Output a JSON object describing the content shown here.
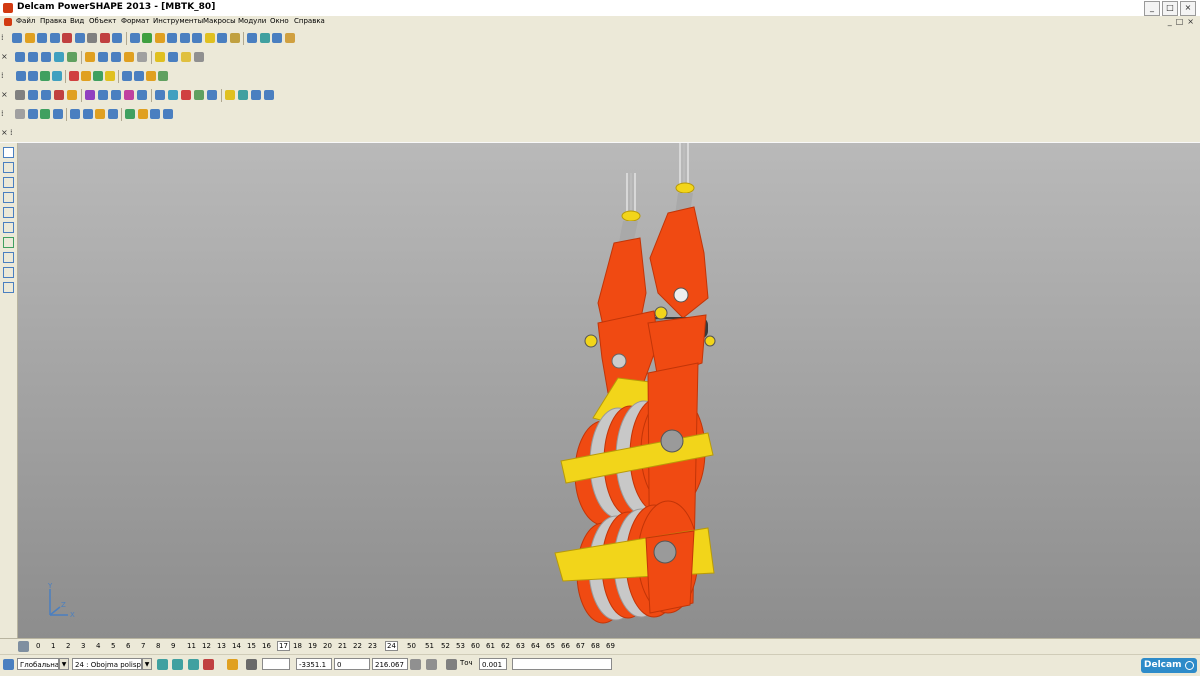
{
  "window": {
    "title": "Delcam PowerSHAPE 2013 - [MBTK_80]",
    "buttons": [
      "_",
      "□",
      "×"
    ],
    "mdi_buttons": [
      "_",
      "□",
      "×"
    ]
  },
  "menu": {
    "items": [
      "Файл",
      "Правка",
      "Вид",
      "Объект",
      "Формат",
      "Инструменты",
      "Макросы",
      "Модули",
      "Окно",
      "Справка"
    ]
  },
  "toolbars": {
    "row1_colors": [
      "#4a7fc0",
      "#e0a020",
      "#4a7fc0",
      "#4a7fc0",
      "#c04040",
      "#4a7fc0",
      "#808080",
      "#c04040",
      "#4a7fc0",
      "#4a7fc0",
      "#40a040",
      "#e0a020",
      "#4a7fc0",
      "#4a7fc0",
      "#4a7fc0",
      "#e0c020",
      "#4a7fc0",
      "#c0a040",
      "#4a7fc0",
      "#40a0a0",
      "#4a7fc0",
      "#d0a040"
    ],
    "row2_colors": [
      "#4a7fc0",
      "#4a7fc0",
      "#4a7fc0",
      "#40a0c0",
      "#60a060",
      "#e0a020",
      "#4a7fc0",
      "#4a7fc0",
      "#e0a020",
      "#a0a0a0",
      "#e0c020",
      "#4a7fc0",
      "#e0c040",
      "#909090"
    ],
    "row3_colors": [
      "#4a7fc0",
      "#4a7fc0",
      "#40a060",
      "#40a0c0",
      "#d04040",
      "#e0a020",
      "#40a060",
      "#e0c020",
      "#4a7fc0",
      "#4a7fc0",
      "#e0a020",
      "#60a060"
    ],
    "row4_colors": [
      "#808080",
      "#4a7fc0",
      "#4a7fc0",
      "#c04040",
      "#e0a020",
      "#9040c0",
      "#4a7fc0",
      "#4a7fc0",
      "#c040a0",
      "#4a7fc0",
      "#4a7fc0",
      "#40a0c0",
      "#d04040",
      "#60a060",
      "#4a7fc0",
      "#e0c020",
      "#40a0a0",
      "#4a7fc0",
      "#4a7fc0"
    ],
    "row5_colors": [
      "#a0a0a0",
      "#4a7fc0",
      "#40a060",
      "#4a7fc0",
      "#4a7fc0",
      "#4a7fc0",
      "#e0a020",
      "#4a7fc0",
      "#40a060",
      "#e0a020",
      "#4a7fc0",
      "#4a7fc0"
    ]
  },
  "left_tools": [
    "select-icon",
    "quick-select-icon",
    "line-icon",
    "curve-icon",
    "rectangle-icon",
    "circle-icon",
    "solid-icon",
    "dimension-icon",
    "arc-icon",
    "axes-icon"
  ],
  "model": {
    "name": "MBTK_80",
    "colors": {
      "body": "#f04a12",
      "body_dark": "#c23508",
      "brackets": "#f2d51a",
      "brackets_dark": "#b89a08",
      "sheave": "#c8c8c8",
      "rope": "#d8d8d8",
      "axle": "#3a3a3a"
    }
  },
  "triad": {
    "y": "Y",
    "x": "X",
    "z": "Z"
  },
  "layers": {
    "items": [
      "0",
      "1",
      "2",
      "3",
      "4",
      "5",
      "6",
      "7",
      "8",
      "9",
      "11",
      "12",
      "13",
      "14",
      "15",
      "16",
      "17",
      "18",
      "19",
      "20",
      "21",
      "22",
      "23",
      "24",
      "50",
      "51",
      "52",
      "53",
      "60",
      "61",
      "62",
      "63",
      "64",
      "65",
      "66",
      "67",
      "68",
      "69"
    ],
    "selected": [
      "17",
      "24"
    ]
  },
  "status": {
    "workplane": "Глобальна",
    "level": "24  : Obojma polispas",
    "x": "-3351.1",
    "y": "0",
    "z": "216.067",
    "tolerance_label": "Точ",
    "tolerance": "0.001",
    "brand": "Delcam"
  }
}
